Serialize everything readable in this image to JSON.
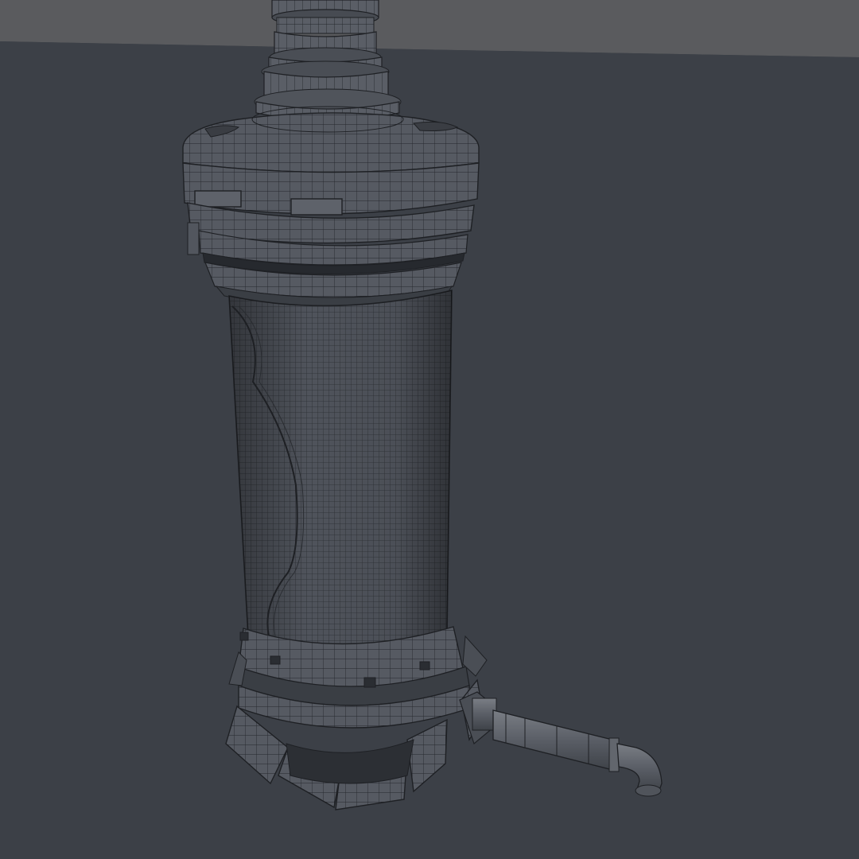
{
  "viewport": {
    "background_color": "#3b3f46",
    "backdrop_wall_color": "#5a5b5e",
    "floor_color": "#3c4047",
    "model_fill_color": "#52565e",
    "model_shade_color": "#42464d",
    "model_highlight_color": "#6a6e75",
    "wire_color": "#1e2024"
  },
  "model": {
    "parts": [
      "top-pipe",
      "upper-collar",
      "head-cap",
      "head-ring",
      "mesh-tank",
      "base-ring",
      "base-fins",
      "outlet-pipe"
    ]
  }
}
